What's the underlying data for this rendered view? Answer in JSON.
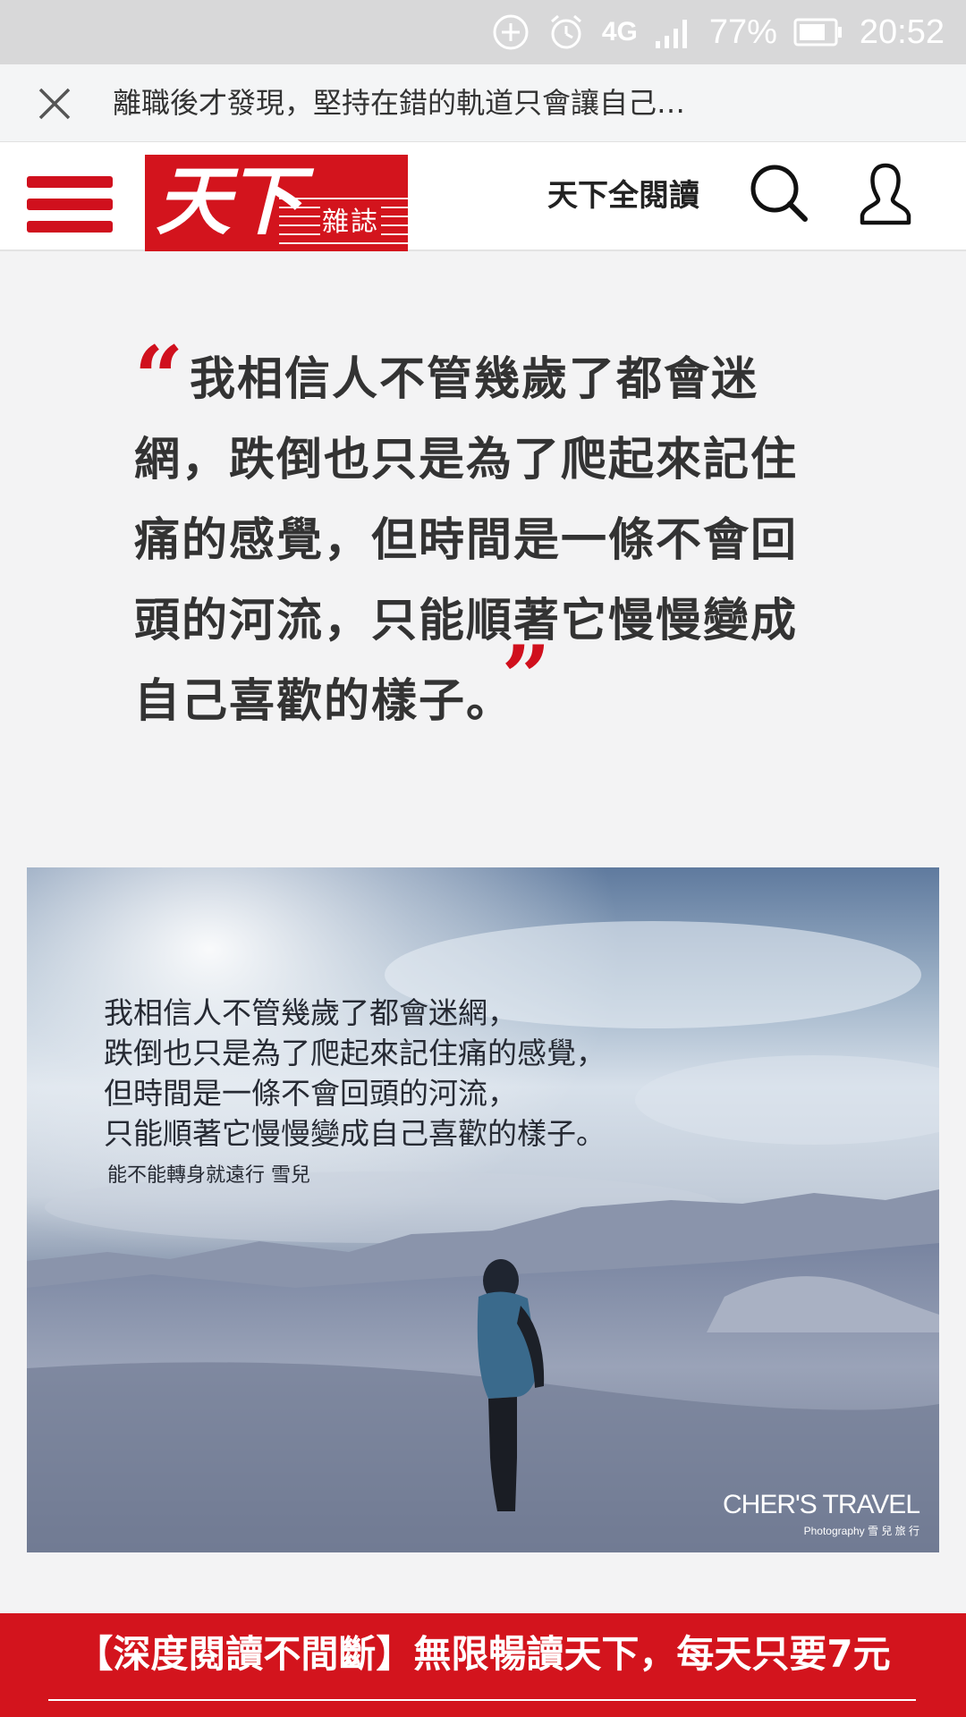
{
  "status_bar": {
    "network": "4G",
    "battery": "77%",
    "time": "20:52"
  },
  "title_bar": {
    "title": "離職後才發現，堅持在錯的軌道只會讓自己…"
  },
  "header": {
    "logo_main": "天下",
    "logo_sub": "雜誌",
    "read_all": "天下全閱讀"
  },
  "quote": {
    "lines": [
      "我相信人不管幾歲了都會迷",
      "網，跌倒也只是為了爬起來記住",
      "痛的感覺，但時間是一條不會回",
      "頭的河流，只能順著它慢慢變成",
      "自己喜歡的樣子。"
    ]
  },
  "photo": {
    "text_lines": [
      "我相信人不管幾歲了都會迷網，",
      "跌倒也只是為了爬起來記住痛的感覺，",
      "但時間是一條不會回頭的河流，",
      "只能順著它慢慢變成自己喜歡的樣子。"
    ],
    "author": "能不能轉身就遠行 雪兒",
    "credit": "CHER'S TRAVEL",
    "credit_sub": "Photography 雪 兒 旅 行"
  },
  "banner": {
    "text": "【深度閱讀不間斷】無限暢讀天下，每天只要7元"
  },
  "colors": {
    "brand_red": "#d3141d",
    "status_bar": "#d8d8d9",
    "page_bg": "#f3f3f4"
  },
  "icons": [
    "add-circle-icon",
    "alarm-icon",
    "signal-icon",
    "battery-icon",
    "close-icon",
    "hamburger-menu-icon",
    "search-icon",
    "user-icon",
    "quote-open-icon",
    "quote-close-icon"
  ]
}
